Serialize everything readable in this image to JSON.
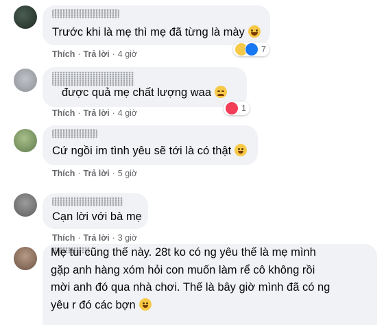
{
  "comments": [
    {
      "text": "Trước khi là mẹ thì mẹ đã từng là mày",
      "like": "Thích",
      "reply": "Trả lời",
      "time": "4 giờ",
      "reaction_count": "7",
      "reactions": [
        "haha-reaction-icon",
        "like-reaction-icon"
      ]
    },
    {
      "text": "được quả mẹ chất lượng waa",
      "like": "Thích",
      "reply": "Trả lời",
      "time": "4 giờ",
      "reaction_count": "1",
      "reactions": [
        "love-reaction-icon"
      ]
    },
    {
      "text": "Cứ ngồi im tình yêu sẽ tới là có thật",
      "like": "Thích",
      "reply": "Trả lời",
      "time": "5 giờ"
    },
    {
      "text": "Cạn lời với bà mẹ",
      "like": "Thích",
      "reply": "Trả lời",
      "time": "3 giờ"
    },
    {
      "text": "Mẹ tui cũng thế này. 28t ko có ng yêu thế là mẹ mình\ngặp anh hàng xóm hỏi con muốn làm rể cô không rồi\nmời anh đó qua nhà chơi. Thế là bây giờ mình đã có ng\nyêu r đó các bợn"
    }
  ],
  "colors": {
    "bubble": "#f0f2f5",
    "meta": "#65676b",
    "like_blue": "#1877f2",
    "love_red": "#f33e58"
  }
}
